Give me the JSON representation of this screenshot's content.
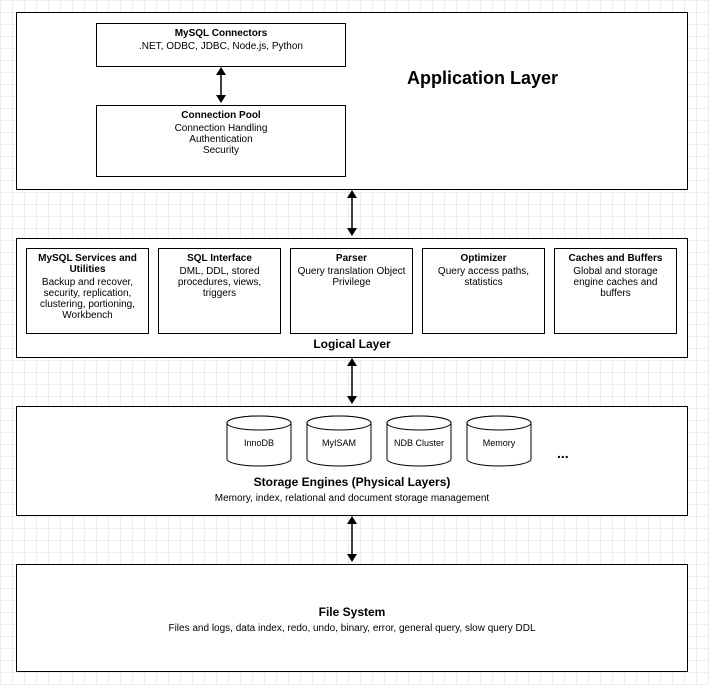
{
  "app_layer": {
    "title": "Application Layer",
    "connectors": {
      "title": "MySQL Connectors",
      "text": ".NET, ODBC, JDBC, Node.js, Python"
    },
    "pool": {
      "title": "Connection Pool",
      "line1": "Connection Handling",
      "line2": "Authentication",
      "line3": "Security"
    }
  },
  "logical_layer": {
    "label": "Logical Layer",
    "boxes": [
      {
        "title": "MySQL Services and Utilities",
        "text": "Backup and recover, security, replication, clustering, portioning, Workbench"
      },
      {
        "title": "SQL Interface",
        "text": "DML, DDL, stored procedures, views, triggers"
      },
      {
        "title": "Parser",
        "text": "Query translation Object Privilege"
      },
      {
        "title": "Optimizer",
        "text": "Query access paths, statistics"
      },
      {
        "title": "Caches and Buffers",
        "text": "Global and storage engine caches and buffers"
      }
    ]
  },
  "storage_layer": {
    "title": "Storage Engines (Physical Layers)",
    "subtitle": "Memory, index, relational and document storage management",
    "engines": [
      "InnoDB",
      "MyISAM",
      "NDB Cluster",
      "Memory"
    ],
    "ellipsis": "..."
  },
  "file_system": {
    "title": "File System",
    "text": "Files and logs, data index, redo, undo, binary, error, general query, slow query DDL"
  }
}
